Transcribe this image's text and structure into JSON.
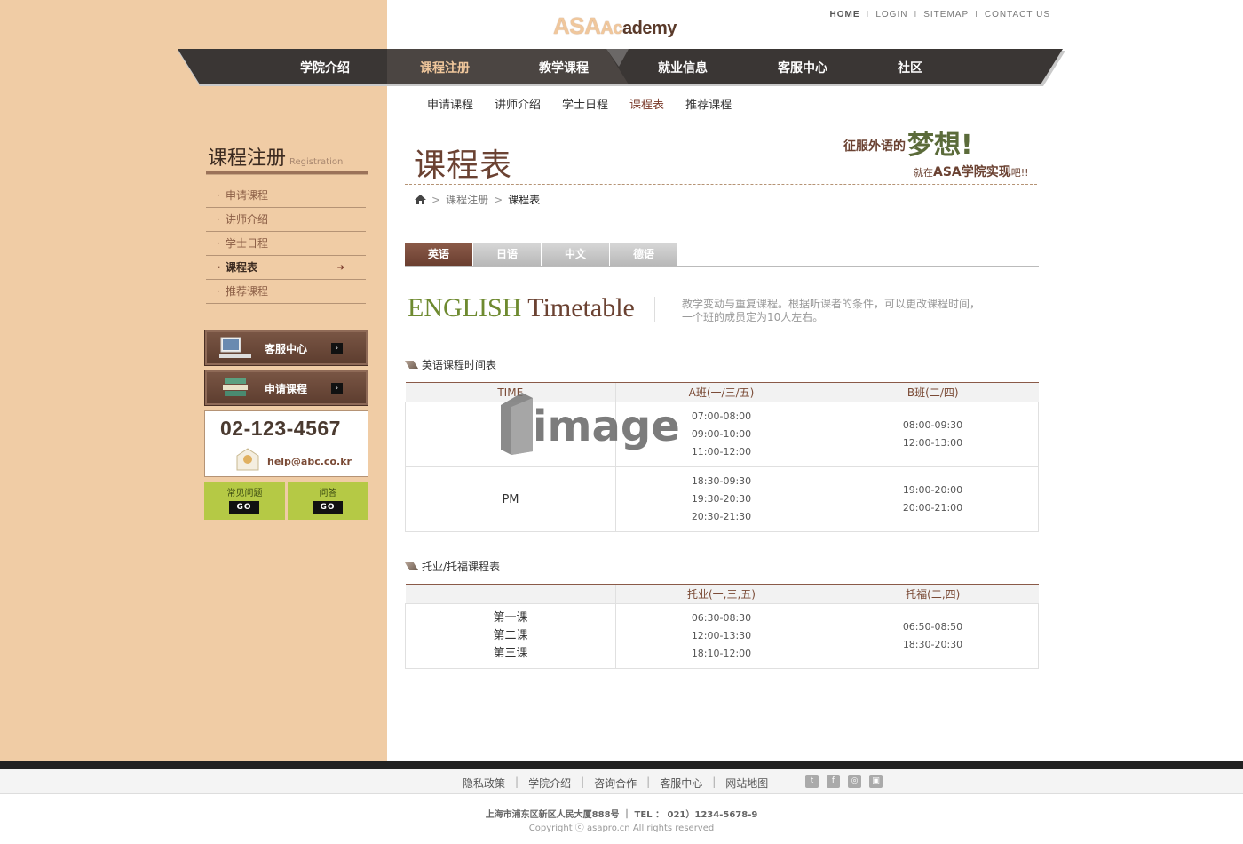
{
  "top_links": [
    "HOME",
    "LOGIN",
    "SITEMAP",
    "CONTACT US"
  ],
  "logo": {
    "part1": "ASA",
    "part2": "Ac",
    "part3": "ademy"
  },
  "main_nav": [
    "学院介绍",
    "课程注册",
    "教学课程",
    "就业信息",
    "客服中心",
    "社区"
  ],
  "sub_nav": [
    "申请课程",
    "讲师介绍",
    "学士日程",
    "课程表",
    "推荐课程"
  ],
  "sidebar": {
    "title": "课程注册",
    "title_en": "Registration",
    "items": [
      "申请课程",
      "讲师介绍",
      "学士日程",
      "课程表",
      "推荐课程"
    ],
    "btn_service": "客服中心",
    "btn_apply": "申请课程",
    "phone": "02-123-4567",
    "email": "help@abc.co.kr",
    "faq": "常见问题",
    "qa": "问答",
    "go": "GO"
  },
  "page": {
    "title": "课程表",
    "promo_l1": "征服外语的",
    "promo_dream": "梦想!",
    "promo_l2a": "就在",
    "promo_l2b": "ASA学院实现",
    "promo_l2c": "吧!!",
    "breadcrumb": [
      "课程注册",
      "课程表"
    ]
  },
  "tabs": [
    "英语",
    "日语",
    "中文",
    "德语"
  ],
  "timetable_heading": {
    "part1": "ENGLISH",
    "part2": "Timetable"
  },
  "timetable_desc": "教学变动与重复课程。根据听课者的条件，可以更改课程时间，一个班的成员定为10人左右。",
  "section1": {
    "title": "英语课程时间表",
    "headers": [
      "TIME",
      "A班(一/三/五)",
      "B班(二/四)"
    ],
    "rows": [
      {
        "label": "",
        "a": [
          "07:00-08:00",
          "09:00-10:00",
          "11:00-12:00"
        ],
        "b": [
          "08:00-09:30",
          "12:00-13:00"
        ]
      },
      {
        "label": "PM",
        "a": [
          "18:30-09:30",
          "19:30-20:30",
          "20:30-21:30"
        ],
        "b": [
          "19:00-20:00",
          "20:00-21:00"
        ]
      }
    ]
  },
  "section2": {
    "title": "托业/托福课程表",
    "headers": [
      "",
      "托业(一,三,五)",
      "托福(二,四)"
    ],
    "labels": [
      "第一课",
      "第二课",
      "第三课"
    ],
    "a": [
      "06:30-08:30",
      "12:00-13:30",
      "18:10-12:00"
    ],
    "b": [
      "06:50-08:50",
      "18:30-20:30"
    ]
  },
  "watermark": "imageDJ",
  "footer": {
    "links": [
      "隐私政策",
      "学院介绍",
      "咨询合作",
      "客服中心",
      "网站地图"
    ],
    "address": "上海市浦东区新区人民大厦888号 ｜ TEL ： 021）1234-5678-9",
    "copyright": "Copyright ⓒ asapro.cn All rights reserved"
  }
}
